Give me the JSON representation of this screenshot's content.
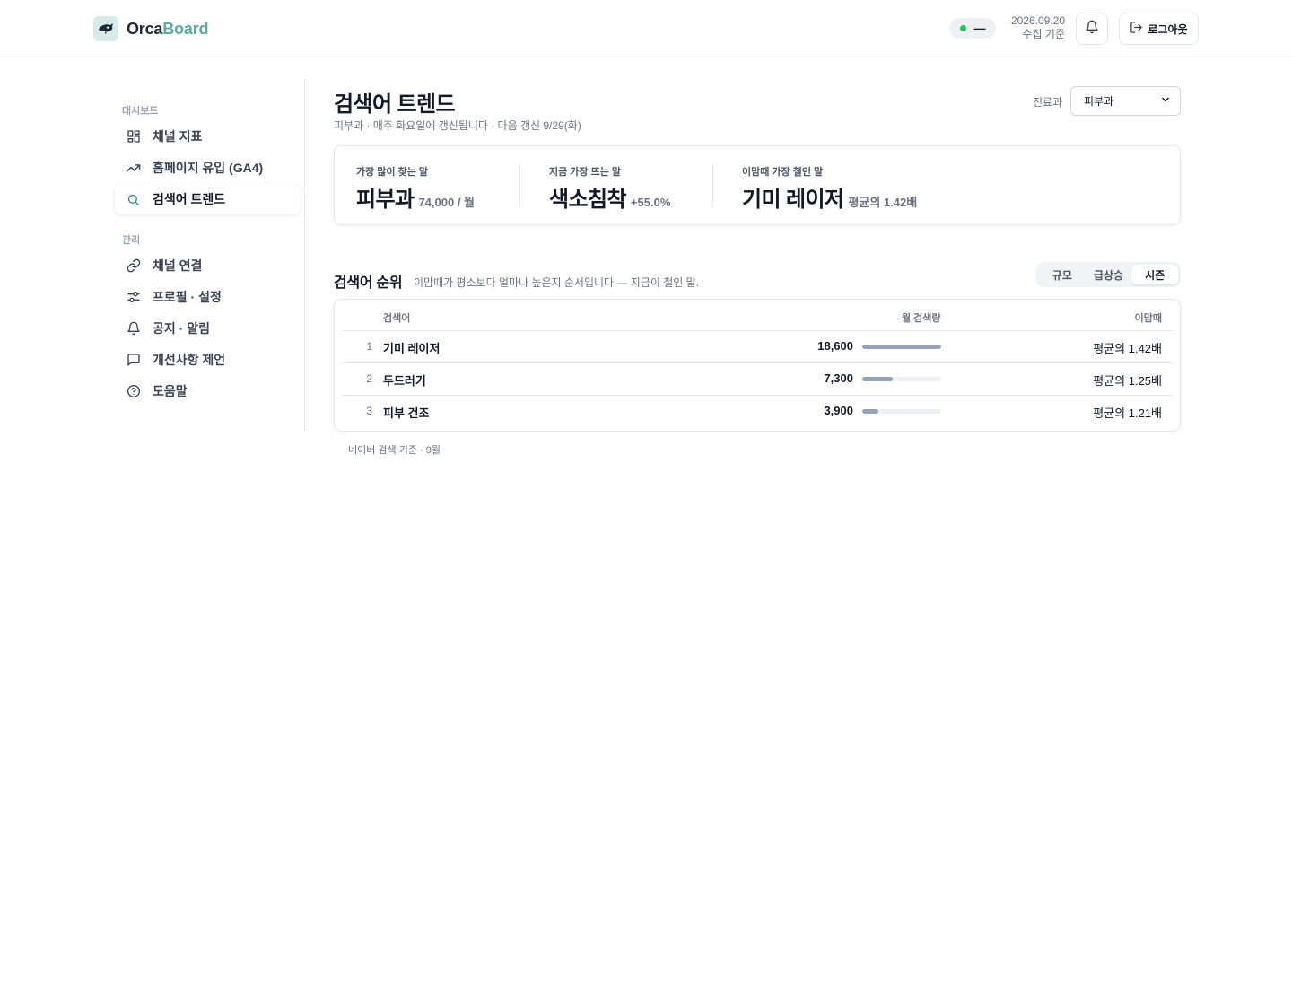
{
  "header": {
    "brand_part1": "Orca",
    "brand_part2": "Board",
    "status_text": "—",
    "date": "2026.09.20",
    "date_caption": "수집 기준",
    "logout_label": "로그아웃",
    "status_color": "#22c55e",
    "brand_accent_color": "#5fa8a0"
  },
  "sidebar": {
    "section_dashboard": "대시보드",
    "section_manage": "관리",
    "dashboard_items": [
      {
        "label": "채널 지표",
        "icon": "grid-icon"
      },
      {
        "label": "홈페이지 유입 (GA4)",
        "icon": "trending-up-icon"
      },
      {
        "label": "검색어 트렌드",
        "icon": "search-icon",
        "active": true
      }
    ],
    "manage_items": [
      {
        "label": "채널 연결",
        "icon": "link-icon"
      },
      {
        "label": "프로필 · 설정",
        "icon": "sliders-icon"
      },
      {
        "label": "공지 · 알림",
        "icon": "bell-icon"
      },
      {
        "label": "개선사항 제언",
        "icon": "message-icon"
      },
      {
        "label": "도움말",
        "icon": "help-circle-icon"
      }
    ]
  },
  "page": {
    "title": "검색어 트렌드",
    "subtitle": "피부과 · 매주 화요일에 갱신됩니다 · 다음 갱신 9/29(화)",
    "dept_label": "진료과",
    "dept_selected": "피부과"
  },
  "summary": [
    {
      "label": "가장 많이 찾는 말",
      "value": "피부과",
      "meta": "74,000 / 월"
    },
    {
      "label": "지금 가장 뜨는 말",
      "value": "색소침착",
      "meta": "+55.0%"
    },
    {
      "label": "이맘때 가장 철인 말",
      "value": "기미 레이저",
      "meta": "평균의 1.42배"
    }
  ],
  "ranking": {
    "title": "검색어 순위",
    "description": "이맘때가 평소보다 얼마나 높은지 순서입니다 — 지금이 철인 말.",
    "tabs": [
      {
        "label": "규모",
        "active": false
      },
      {
        "label": "급상승",
        "active": false
      },
      {
        "label": "시즌",
        "active": true
      }
    ],
    "columns": {
      "term": "검색어",
      "volume": "월 검색량",
      "season": "이맘때"
    },
    "rows": [
      {
        "rank": "1",
        "term": "기미 레이저",
        "volume": "18,600",
        "volume_share": 1.0,
        "season": "평균의 1.42배"
      },
      {
        "rank": "2",
        "term": "두드러기",
        "volume": "7,300",
        "volume_share": 0.392,
        "season": "평균의 1.25배"
      },
      {
        "rank": "3",
        "term": "피부 건조",
        "volume": "3,900",
        "volume_share": 0.21,
        "season": "평균의 1.21배"
      }
    ],
    "footnote": "네이버 검색 기준 · 9월"
  }
}
